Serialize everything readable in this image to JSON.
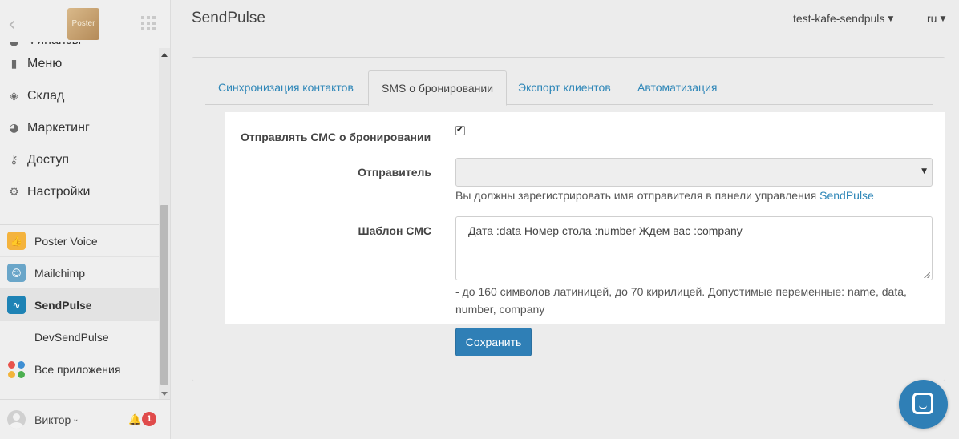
{
  "sidebar": {
    "logo_text": "Poster",
    "menu": [
      {
        "label": "Финансы",
        "icon": "finance-icon"
      },
      {
        "label": "Меню",
        "icon": "menu-icon"
      },
      {
        "label": "Склад",
        "icon": "warehouse-icon"
      },
      {
        "label": "Маркетинг",
        "icon": "marketing-icon"
      },
      {
        "label": "Доступ",
        "icon": "key-icon"
      },
      {
        "label": "Настройки",
        "icon": "gear-icon"
      }
    ],
    "apps": [
      {
        "label": "Poster Voice",
        "icon": "thumbs-up-icon",
        "color": "#f4b33d"
      },
      {
        "label": "Mailchimp",
        "icon": "mailchimp-icon",
        "color": "#6aa6c9"
      },
      {
        "label": "SendPulse",
        "icon": "pulse-icon",
        "color": "#1e83b5"
      },
      {
        "label": "DevSendPulse"
      },
      {
        "label": "Все приложения",
        "icon": "apps-grid-icon"
      }
    ],
    "user": {
      "name": "Виктор",
      "notifications": "1"
    }
  },
  "header": {
    "title": "SendPulse",
    "account": "test-kafe-sendpuls",
    "language": "ru"
  },
  "tabs": [
    {
      "label": "Синхронизация контактов"
    },
    {
      "label": "SMS о бронировании"
    },
    {
      "label": "Экспорт клиентов"
    },
    {
      "label": "Автоматизация"
    }
  ],
  "form": {
    "send_sms_label": "Отправлять СМС о бронировании",
    "send_sms_checked": true,
    "sender_label": "Отправитель",
    "sender_value": "",
    "sender_hint": "Вы должны зарегистрировать имя отправителя в панели управления ",
    "sender_hint_link": "SendPulse",
    "template_label": "Шаблон СМС",
    "template_value": "Дата :data Номер стола :number Ждем вас :company",
    "template_hint_line1": "- до 160 символов латиницей, до 70 кирилицей. Допустимые переменные: name, data,",
    "template_hint_line2": "number, company",
    "save_label": "Сохранить"
  },
  "colors": {
    "accent": "#2f7fb6",
    "link": "#2f87b8",
    "badge": "#e04b4b"
  }
}
